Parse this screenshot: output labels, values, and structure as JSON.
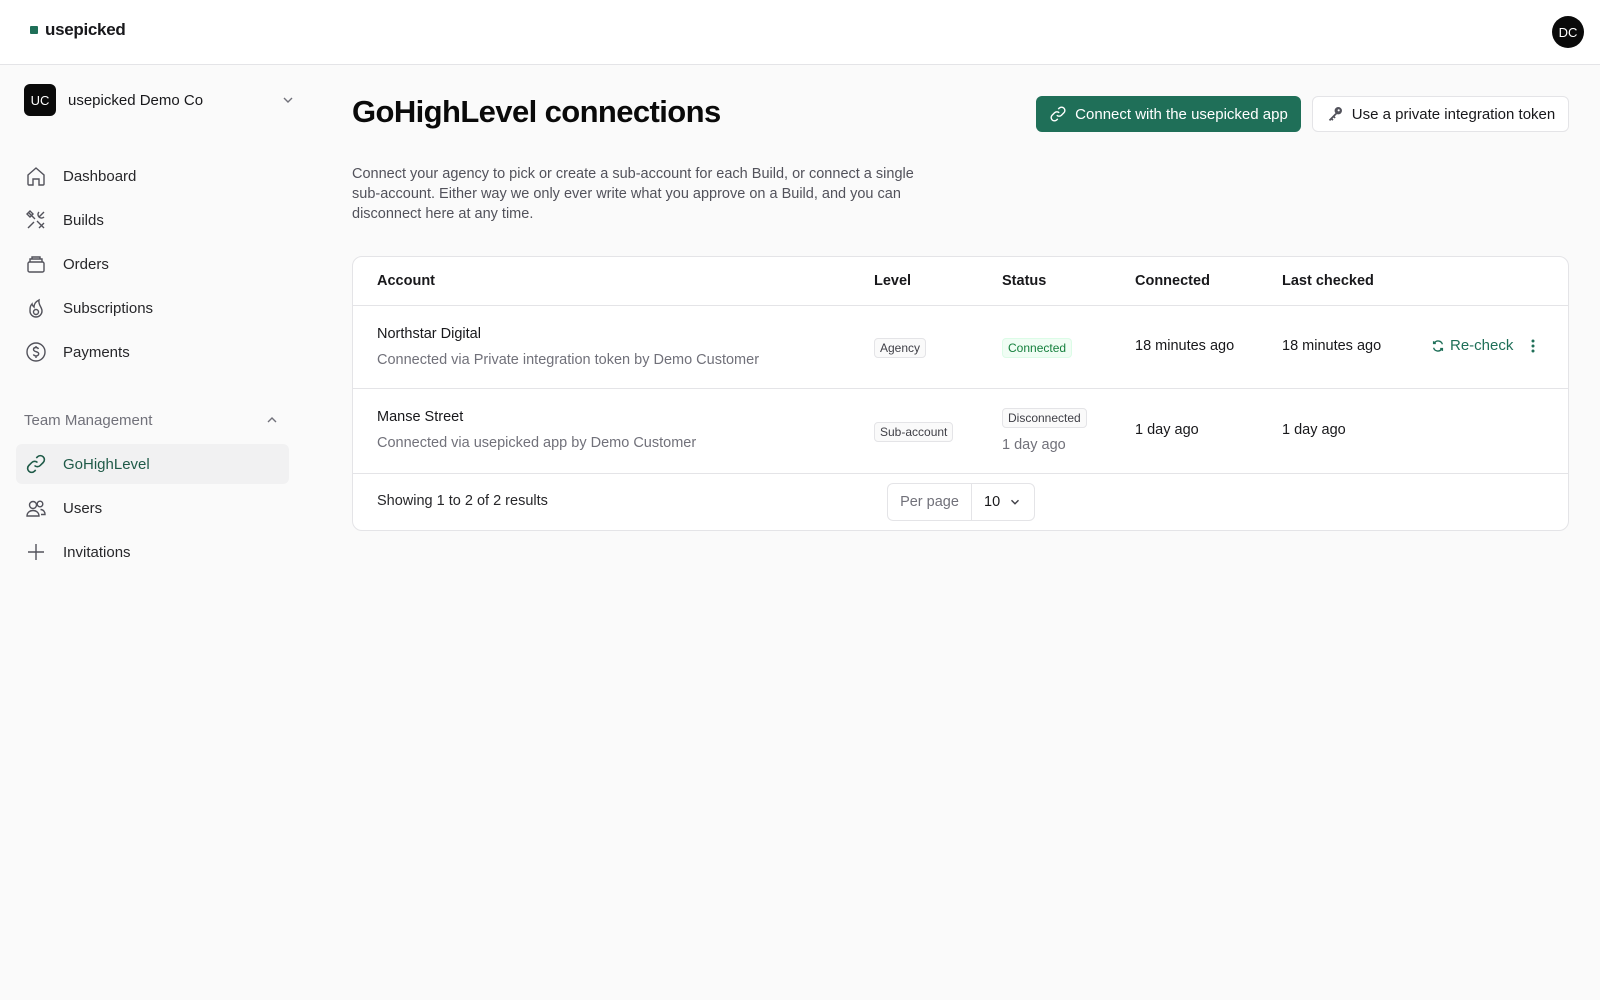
{
  "app": {
    "brand": "usepicked",
    "brand_color": "#1f6f58",
    "user_initials": "DC"
  },
  "sidebar": {
    "org": {
      "initials": "UC",
      "name": "usepicked Demo Co",
      "icon": "chevron-down-icon"
    },
    "items": [
      {
        "label": "Dashboard",
        "icon": "home-icon"
      },
      {
        "label": "Builds",
        "icon": "tools-icon"
      },
      {
        "label": "Orders",
        "icon": "archive-icon"
      },
      {
        "label": "Subscriptions",
        "icon": "flame-icon"
      },
      {
        "label": "Payments",
        "icon": "dollar-circle-icon"
      }
    ],
    "team_section": {
      "label": "Team Management",
      "icon": "chevron-up-icon",
      "items": [
        {
          "label": "GoHighLevel",
          "icon": "link-icon",
          "active": true
        },
        {
          "label": "Users",
          "icon": "users-icon"
        },
        {
          "label": "Invitations",
          "icon": "plus-icon"
        }
      ]
    }
  },
  "main": {
    "title": "GoHighLevel connections",
    "primary_button": "Connect with the usepicked app",
    "secondary_button": "Use a private integration token",
    "description": "Connect your agency to pick or create a sub-account for each Build, or connect a single sub-account. Either way we only ever write what you approve on a Build, and you can disconnect here at any time.",
    "table": {
      "columns": [
        "Account",
        "Level",
        "Status",
        "Connected",
        "Last checked"
      ],
      "rows": [
        {
          "name": "Northstar Digital",
          "subtitle": "Connected via Private integration token by Demo Customer",
          "level": "Agency",
          "status": "Connected",
          "status_color": "#15803d",
          "connected": "18 minutes ago",
          "last_checked": "18 minutes ago",
          "action": "Re-check"
        },
        {
          "name": "Manse Street",
          "subtitle": "Connected via usepicked app by Demo Customer",
          "level": "Sub-account",
          "status": "Disconnected",
          "status_detail": "1 day ago",
          "connected": "1 day ago",
          "last_checked": "1 day ago"
        }
      ],
      "footer": {
        "summary": "Showing 1 to 2 of 2 results",
        "per_page_label": "Per page",
        "per_page_value": "10"
      }
    }
  }
}
